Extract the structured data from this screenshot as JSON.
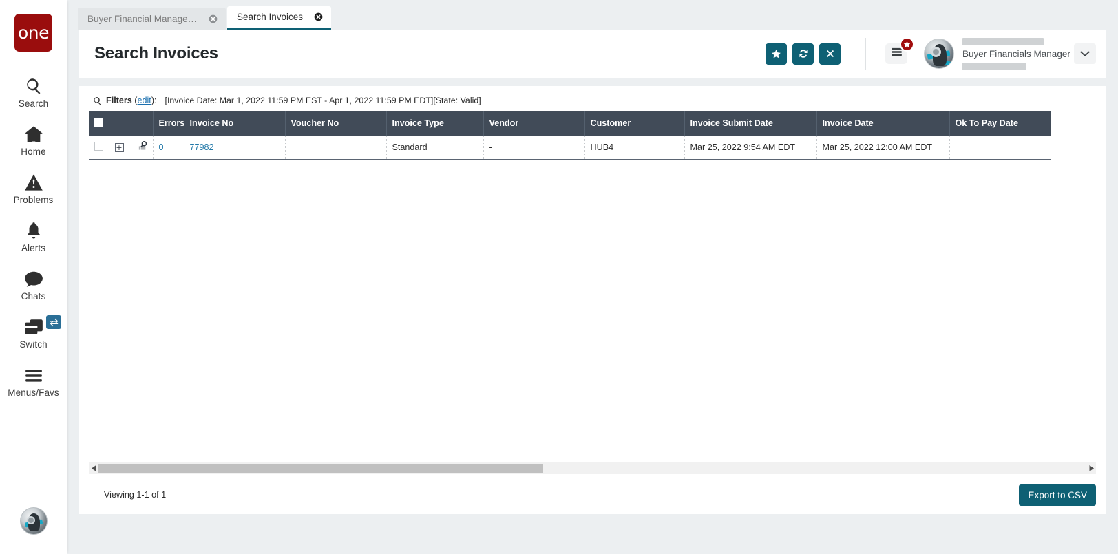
{
  "brand": {
    "logo_text": "one",
    "logo_color": "#9a0d0d",
    "accent_teal": "#0e6074"
  },
  "sidebar": {
    "items": [
      {
        "label": "Search",
        "icon": "search-icon"
      },
      {
        "label": "Home",
        "icon": "home-icon"
      },
      {
        "label": "Problems",
        "icon": "warning-triangle-icon"
      },
      {
        "label": "Alerts",
        "icon": "bell-icon"
      },
      {
        "label": "Chats",
        "icon": "chat-bubble-icon"
      },
      {
        "label": "Switch",
        "icon": "switch-windows-icon",
        "badge_icon": "swap-arrows-icon"
      },
      {
        "label": "Menus/Favs",
        "icon": "hamburger-icon"
      }
    ]
  },
  "tabs": [
    {
      "label": "Buyer Financial Manager Dashb...",
      "active": false,
      "close_icon": "close-circle-icon"
    },
    {
      "label": "Search Invoices",
      "active": true,
      "close_icon": "close-circle-icon"
    }
  ],
  "header": {
    "title": "Search Invoices",
    "actions": [
      {
        "name": "favorite-button",
        "icon": "star-icon"
      },
      {
        "name": "refresh-button",
        "icon": "refresh-icon"
      },
      {
        "name": "close-button",
        "icon": "x-icon"
      }
    ],
    "menus_button": {
      "icon": "hamburger-icon",
      "badge_icon": "star-icon"
    },
    "user": {
      "name": "Buyer Financials Manager",
      "avatar": "user-avatar",
      "caret_icon": "chevron-down-icon"
    }
  },
  "filters": {
    "icon": "search-icon",
    "label": "Filters",
    "edit_link": "edit",
    "colon": ":",
    "values": "[Invoice Date: Mar 1, 2022 11:59 PM EST - Apr 1, 2022 11:59 PM EDT][State: Valid]"
  },
  "table": {
    "columns": [
      {
        "key": "select",
        "label": ""
      },
      {
        "key": "expand",
        "label": ""
      },
      {
        "key": "audit",
        "label": ""
      },
      {
        "key": "errors",
        "label": "Errors"
      },
      {
        "key": "invoice_no",
        "label": "Invoice No"
      },
      {
        "key": "voucher_no",
        "label": "Voucher No"
      },
      {
        "key": "invoice_type",
        "label": "Invoice Type"
      },
      {
        "key": "vendor",
        "label": "Vendor"
      },
      {
        "key": "customer",
        "label": "Customer"
      },
      {
        "key": "invoice_submit_date",
        "label": "Invoice Submit Date"
      },
      {
        "key": "invoice_date",
        "label": "Invoice Date"
      },
      {
        "key": "ok_to_pay_date",
        "label": "Ok To Pay Date"
      }
    ],
    "rows": [
      {
        "errors": "0",
        "invoice_no": "77982",
        "voucher_no": "",
        "invoice_type": "Standard",
        "vendor": "-",
        "customer": "HUB4",
        "invoice_submit_date": "Mar 25, 2022 9:54 AM EDT",
        "invoice_date": "Mar 25, 2022 12:00 AM EDT",
        "ok_to_pay_date": "",
        "expand_icon": "plus-box-icon",
        "audit_icon": "document-search-icon"
      }
    ]
  },
  "scrollbar": {
    "left_arrow_icon": "triangle-left-icon",
    "right_arrow_icon": "triangle-right-icon"
  },
  "footer": {
    "viewing": "Viewing 1-1 of 1",
    "export_label": "Export to CSV"
  }
}
